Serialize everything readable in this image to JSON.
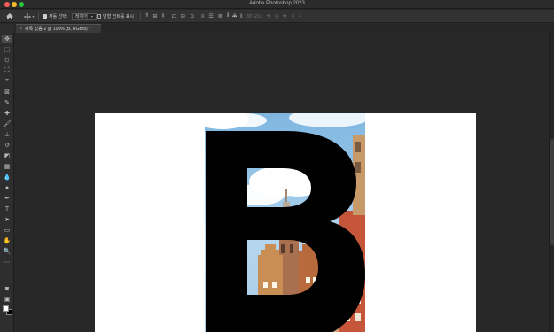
{
  "app": {
    "title": "Adobe Photoshop 2023"
  },
  "options_bar": {
    "auto_select_label": "자동 선택:",
    "auto_select_value": "레이어",
    "show_transform_label": "변형 컨트롤 표시",
    "more_label": "•••",
    "mode_3d_label": "3D 모드:"
  },
  "document": {
    "tab_label": "제목 없음-2 @ 100% (B, RGB/8) *",
    "close_glyph": "×",
    "letter": "B"
  },
  "colors": {
    "foreground": "#ffffff",
    "background": "#000000"
  }
}
